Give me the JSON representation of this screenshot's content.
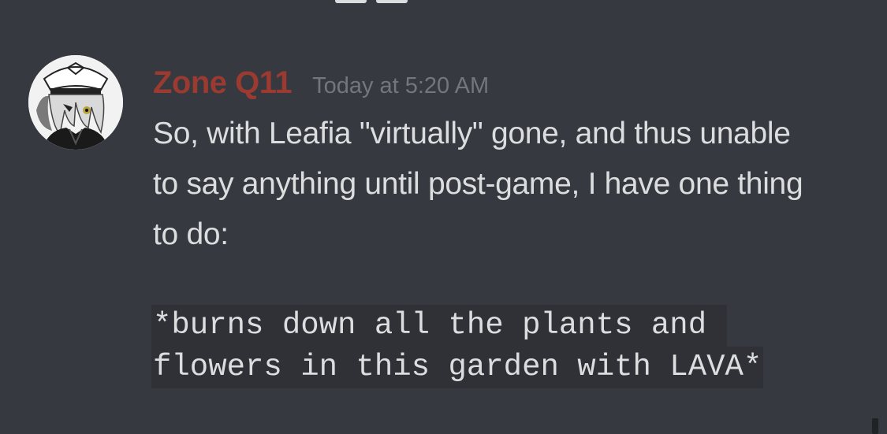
{
  "message": {
    "author": {
      "name": "Zone Q11",
      "color": "#9b3a30"
    },
    "timestamp": "Today at 5:20 AM",
    "text": "So, with Leafia \"virtually\" gone, and thus unable to say anything until post-game, I have one thing to do:",
    "code_lines": [
      "*burns down all the plants and ",
      "flowers in this garden with LAVA*"
    ]
  },
  "colors": {
    "background": "#36393f",
    "text": "#dcddde",
    "timestamp": "#72767d",
    "code_background": "#2f3136"
  }
}
